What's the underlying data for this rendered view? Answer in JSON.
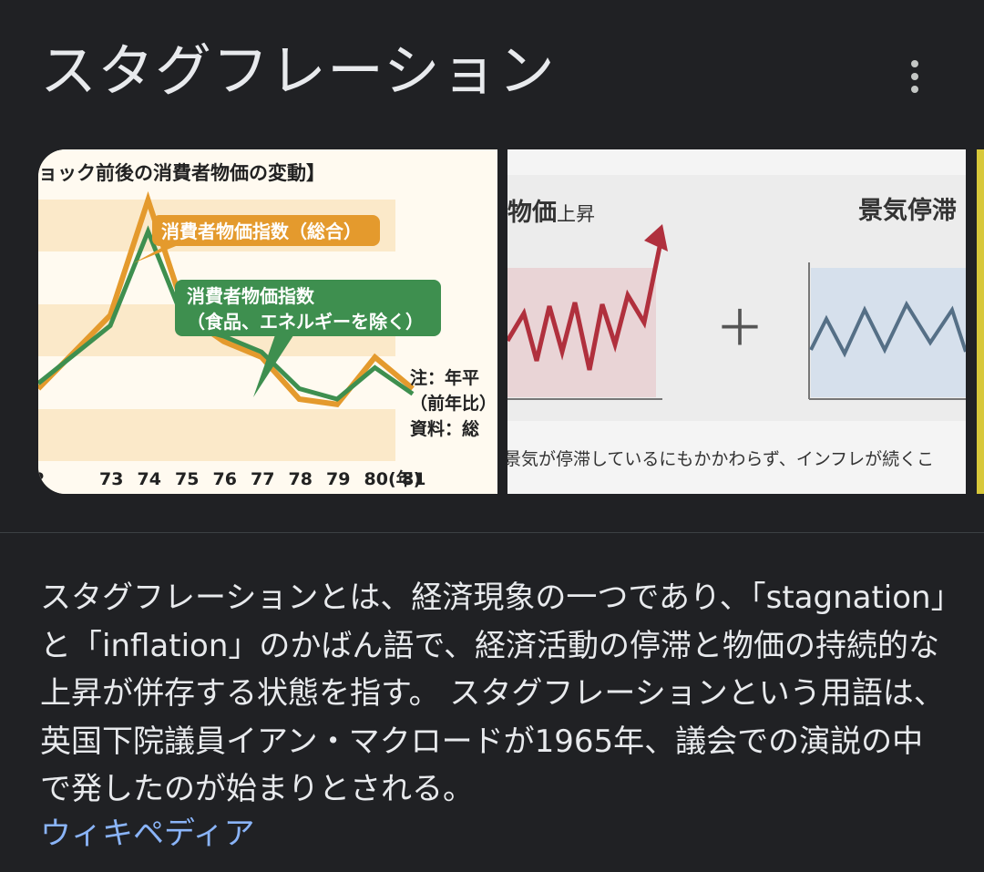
{
  "header": {
    "title": "スタグフレーション",
    "menu_icon": "more-vert-icon"
  },
  "images": [
    {
      "chart_data": {
        "type": "line",
        "title": "ョック前後の消費者物価の変動】",
        "x": [
          "73",
          "74",
          "75",
          "76",
          "77",
          "78",
          "79",
          "80",
          "81"
        ],
        "x_unit": "(年)",
        "x_first_partial": "2",
        "series": [
          {
            "name": "消費者物価指数（総合）",
            "color": "#e49a2d",
            "values": [
              12,
              23,
              12,
              9.5,
              8,
              4,
              3.5,
              8,
              5
            ]
          },
          {
            "name": "消費者物価指数（食品、エネルギーを除く）",
            "color": "#3e8f4f",
            "values": [
              11,
              20,
              11,
              10,
              8.5,
              5,
              4,
              7,
              4.5
            ]
          }
        ],
        "legend_labels": {
          "total": "消費者物価指数（総合）",
          "core_line1": "消費者物価指数",
          "core_line2": "（食品、エネルギーを除く）"
        },
        "notes": [
          "注：年平",
          "（前年比）",
          "資料：総"
        ]
      }
    },
    {
      "label_left_bold": "物価",
      "label_left_rest": "上昇",
      "plus": "＋",
      "label_right": "景気停滞",
      "caption": "景気が停滞しているにもかかわらず、インフレが続くこ"
    }
  ],
  "description": "スタグフレーションとは、経済現象の一つであり、「stagnation」と「inflation」のかばん語で、経済活動の停滞と物価の持続的な上昇が併存する状態を指す。 スタグフレーションという用語は、英国下院議員イアン・マクロードが1965年、議会での演説の中で発したのが始まりとされる。",
  "source_link": "ウィキペディア"
}
